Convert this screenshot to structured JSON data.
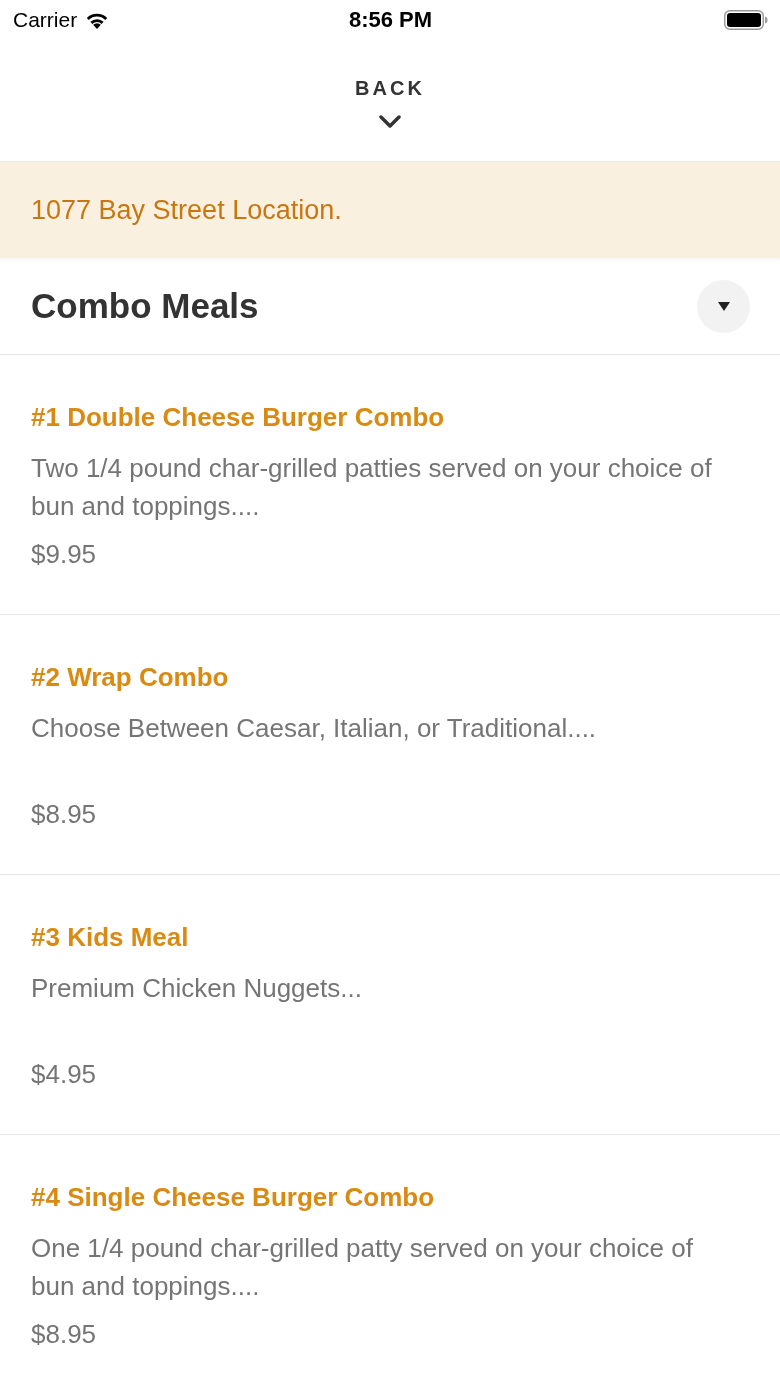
{
  "status_bar": {
    "carrier": "Carrier",
    "time": "8:56 PM"
  },
  "header": {
    "back_label": "BACK"
  },
  "location_banner": {
    "text": "1077 Bay Street Location."
  },
  "section": {
    "title": "Combo Meals"
  },
  "items": [
    {
      "name": "#1 Double Cheese Burger Combo",
      "description": "Two 1/4 pound char-grilled patties served on your choice of bun and toppings....",
      "price": "$9.95"
    },
    {
      "name": "#2 Wrap Combo",
      "description": "Choose Between Caesar, Italian, or Traditional....",
      "price": "$8.95"
    },
    {
      "name": "#3 Kids Meal",
      "description": "Premium Chicken Nuggets...",
      "price": "$4.95"
    },
    {
      "name": "#4 Single Cheese Burger Combo",
      "description": "One 1/4 pound char-grilled patty served on your choice of bun and toppings....",
      "price": "$8.95"
    }
  ]
}
